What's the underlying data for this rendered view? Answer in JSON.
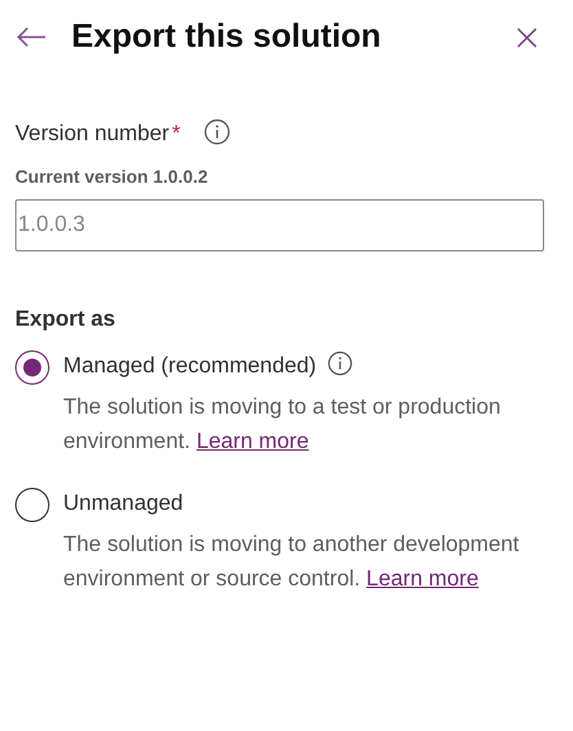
{
  "panel": {
    "title": "Export this solution"
  },
  "version": {
    "label": "Version number",
    "required_mark": "*",
    "current": "Current version 1.0.0.2",
    "placeholder": "1.0.0.3"
  },
  "export_as": {
    "label": "Export as",
    "options": [
      {
        "label": "Managed (recommended)",
        "selected": true,
        "info": true,
        "description": "The solution is moving to a test or production environment.",
        "link": "Learn more"
      },
      {
        "label": "Unmanaged",
        "selected": false,
        "info": false,
        "description": "The solution is moving to another development environment or source control.",
        "link": "Learn more"
      }
    ]
  }
}
